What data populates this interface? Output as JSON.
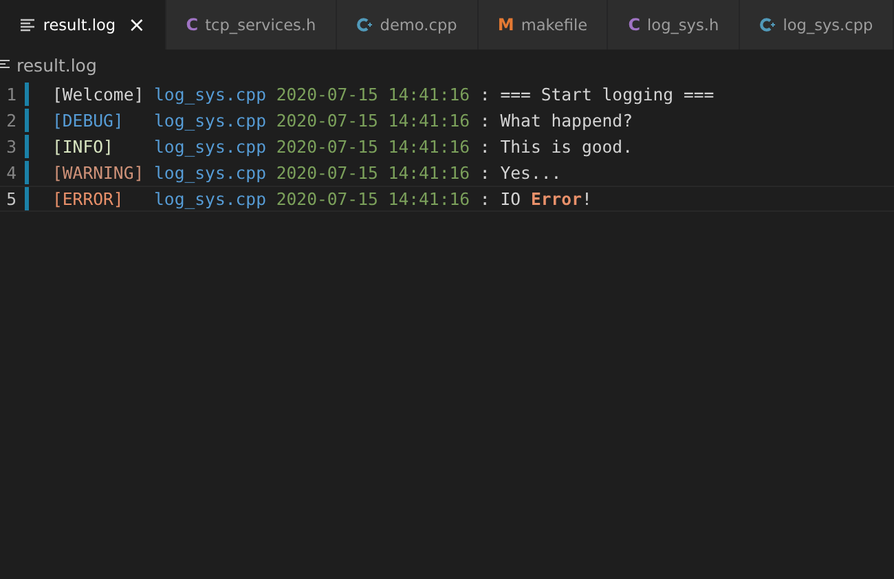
{
  "tabs": [
    {
      "label": "result.log",
      "kind": "log",
      "selected": true,
      "close": "×"
    },
    {
      "label": "tcp_services.h",
      "kind": "c",
      "glyph": "C",
      "selected": false
    },
    {
      "label": "demo.cpp",
      "kind": "cpp",
      "selected": false
    },
    {
      "label": "makefile",
      "kind": "make",
      "glyph": "M",
      "selected": false
    },
    {
      "label": "log_sys.h",
      "kind": "c",
      "glyph": "C",
      "selected": false
    },
    {
      "label": "log_sys.cpp",
      "kind": "cpp",
      "selected": false
    }
  ],
  "breadcrumb": "result.log",
  "lines": [
    {
      "number": "1",
      "kind": "welcome",
      "tag": "[Welcome]",
      "file": "log_sys.cpp",
      "timestamp": "2020-07-15 14:41:16",
      "message": [
        {
          "kind": "plain",
          "text": ": === Start logging ==="
        }
      ],
      "current": false
    },
    {
      "number": "2",
      "kind": "debug",
      "tag": "[DEBUG]",
      "file": "log_sys.cpp",
      "timestamp": "2020-07-15 14:41:16",
      "message": [
        {
          "kind": "plain",
          "text": ": What happend?"
        }
      ],
      "current": false
    },
    {
      "number": "3",
      "kind": "info",
      "tag": "[INFO]",
      "file": "log_sys.cpp",
      "timestamp": "2020-07-15 14:41:16",
      "message": [
        {
          "kind": "plain",
          "text": ": This is good."
        }
      ],
      "current": false
    },
    {
      "number": "4",
      "kind": "warning",
      "tag": "[WARNING]",
      "file": "log_sys.cpp",
      "timestamp": "2020-07-15 14:41:16",
      "message": [
        {
          "kind": "plain",
          "text": ": Yes..."
        }
      ],
      "current": false
    },
    {
      "number": "5",
      "kind": "error",
      "tag": "[ERROR]",
      "file": "log_sys.cpp",
      "timestamp": "2020-07-15 14:41:16",
      "message": [
        {
          "kind": "plain",
          "text": ": IO "
        },
        {
          "kind": "error",
          "text": "Error"
        },
        {
          "kind": "plain",
          "text": "!"
        }
      ],
      "current": true
    }
  ]
}
